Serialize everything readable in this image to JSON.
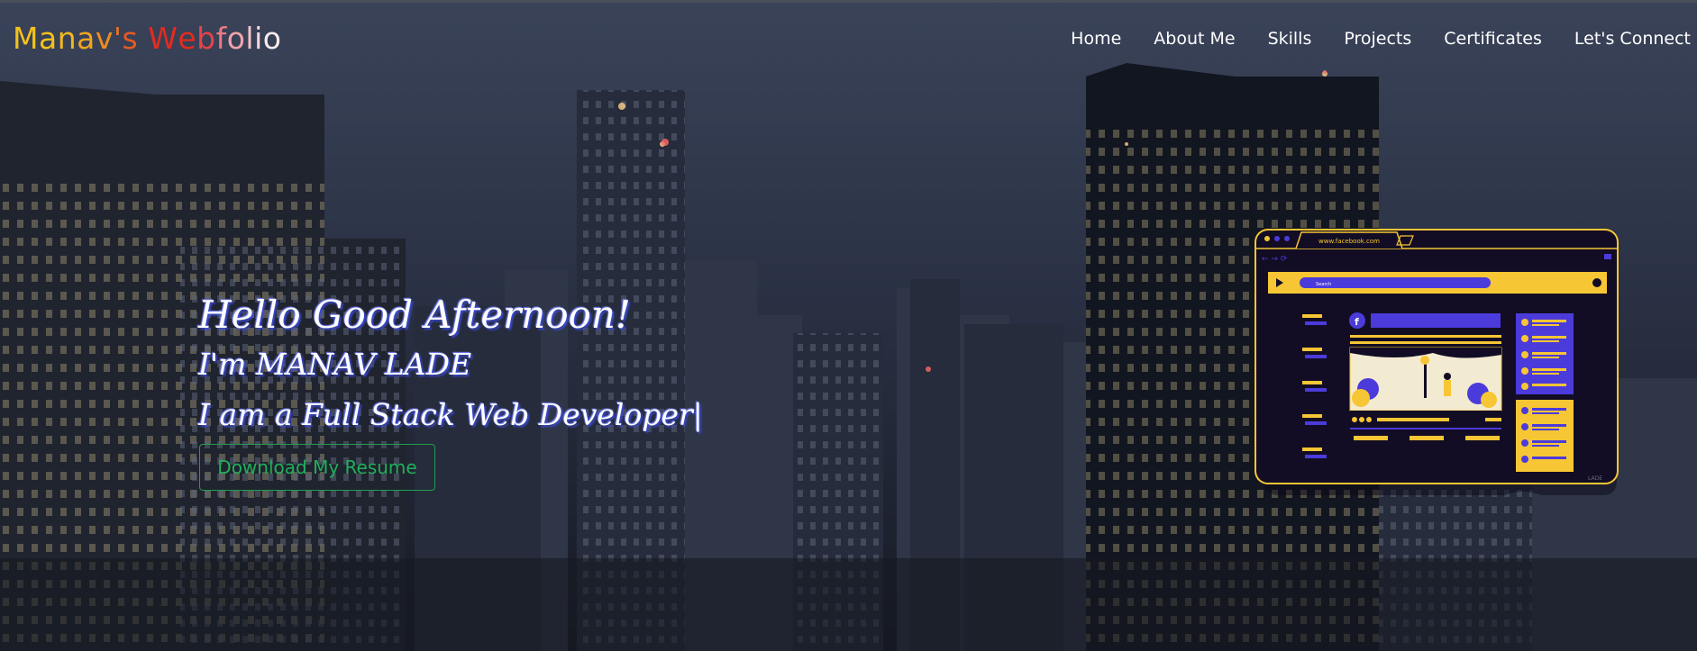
{
  "brand": {
    "parts": [
      "M",
      "a",
      "n",
      "a",
      "v",
      "'",
      "s",
      " ",
      "W",
      "e",
      "b",
      "f",
      "o",
      "l",
      "i",
      "o"
    ],
    "colors": [
      "#f2c21b",
      "#f2c21b",
      "#f2c21b",
      "#f0a81c",
      "#ee8d1e",
      "#ee7420",
      "#e85a22",
      "#ffffff",
      "#e32b1f",
      "#e32b1f",
      "#e8424a",
      "#e86f78",
      "#ee9aa0",
      "#f2bcc0",
      "#f5d5d8",
      "#f8e8ea"
    ]
  },
  "nav": {
    "items": [
      "Home",
      "About Me",
      "Skills",
      "Projects",
      "Certificates",
      "Let's Connect"
    ]
  },
  "hero": {
    "greeting": "Hello Good Afternoon!",
    "name": "I'm MANAV LADE",
    "role": "I am a Full Stack Web Developer",
    "cursor": "|",
    "button": "Download My Resume"
  },
  "illustration": {
    "url": "www.facebook.com",
    "search": "Search",
    "watermark": "LADE"
  },
  "colors": {
    "accent_yellow": "#f7c634",
    "accent_purple": "#4b3bdb",
    "button_green": "#20b05a",
    "screen_bg": "#120d24"
  }
}
